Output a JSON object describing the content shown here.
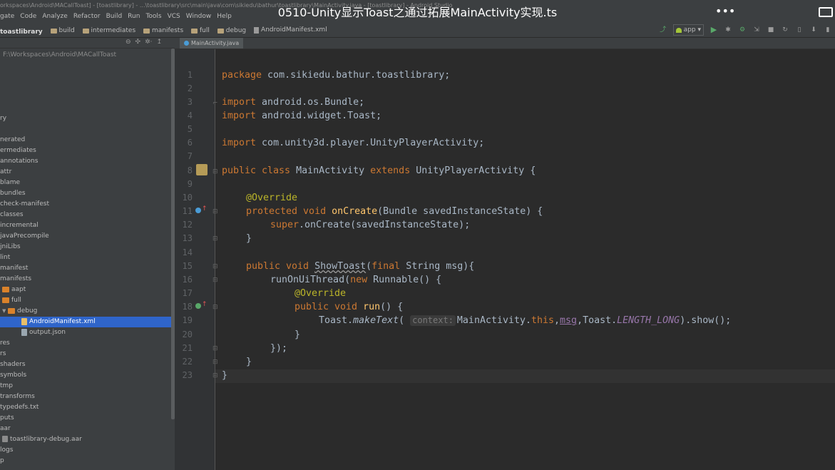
{
  "title_bar": "orkspaces\\Android\\MACallToast] - [toastlibrary] - ...\\toastlibrary\\src\\main\\java\\com\\sikiedu\\bathur\\toastlibrary\\MainActivity.java - [toastlibrary] - Android Studio",
  "menu": [
    "gate",
    "Code",
    "Analyze",
    "Refactor",
    "Build",
    "Run",
    "Tools",
    "VCS",
    "Window",
    "Help"
  ],
  "video_title": "0510-Unity显示Toast之通过拓展MainActivity实现.ts",
  "more_icon": "more-horizontal-icon",
  "breadcrumbs": [
    "toastlibrary",
    "build",
    "intermediates",
    "manifests",
    "full",
    "debug",
    "AndroidManifest.xml"
  ],
  "run_config": "app",
  "sidebar": {
    "path": "F:\\Workspaces\\Android\\MACallToast",
    "items": [
      "ry",
      "nerated",
      "ermediates",
      "annotations",
      "attr",
      "blame",
      "bundles",
      "check-manifest",
      "classes",
      "incremental",
      "javaPrecompile",
      "jniLibs",
      "lint",
      "manifest",
      "manifests",
      "aapt",
      "full",
      "debug",
      "AndroidManifest.xml",
      "output.json",
      "res",
      "rs",
      "shaders",
      "symbols",
      "tmp",
      "transforms",
      "typedefs.txt",
      "puts",
      "aar",
      "toastlibrary-debug.aar",
      "logs",
      "p"
    ]
  },
  "editor": {
    "tab": "MainActivity.java",
    "line_numbers": [
      "1",
      "2",
      "3",
      "4",
      "5",
      "6",
      "7",
      "8",
      "9",
      "10",
      "11",
      "12",
      "13",
      "14",
      "15",
      "16",
      "17",
      "18",
      "19",
      "20",
      "21",
      "22",
      "23"
    ],
    "code": {
      "l1_kw": "package",
      "l1_rest": " com.sikiedu.bathur.toastlibrary;",
      "l3_kw": "import",
      "l3_rest": " android.os.Bundle;",
      "l4_kw": "import",
      "l4_rest": " android.widget.Toast;",
      "l6_kw": "import",
      "l6_rest": " com.unity3d.player.UnityPlayerActivity;",
      "l8_kw1": "public class",
      "l8_name": " MainActivity ",
      "l8_kw2": "extends",
      "l8_rest": " UnityPlayerActivity {",
      "l10_an": "@Override",
      "l11_kw": "protected void",
      "l11_fn": "onCreate",
      "l11_rest": "(Bundle savedInstanceState) {",
      "l12_kw": "super",
      "l12_rest": ".onCreate(savedInstanceState);",
      "l13": "}",
      "l15_kw": "public void",
      "l15_fn": "ShowToast",
      "l15_p1": "(",
      "l15_kw2": "final",
      "l15_rest": " String msg){",
      "l16_a": "runOnUiThread(",
      "l16_kw": "new",
      "l16_rest": " Runnable() {",
      "l17_an": "@Override",
      "l18_kw": "public void",
      "l18_fn": "run",
      "l18_rest": "() {",
      "l19_a": "Toast.",
      "l19_fn": "makeText",
      "l19_p": "(",
      "l19_hint": "context:",
      "l19_b": "MainActivity.",
      "l19_this": "this",
      "l19_c": ",",
      "l19_msg": "msg",
      "l19_d": ",Toast.",
      "l19_const": "LENGTH_LONG",
      "l19_e": ").show();",
      "l20": "}",
      "l21": "});",
      "l22": "}",
      "l23": "}"
    }
  },
  "colors": {
    "keyword": "#cc7832",
    "annotation": "#bbb529",
    "method": "#ffc66d",
    "constant": "#9876aa",
    "text": "#a9b7c6",
    "selection": "#2f65ca"
  }
}
